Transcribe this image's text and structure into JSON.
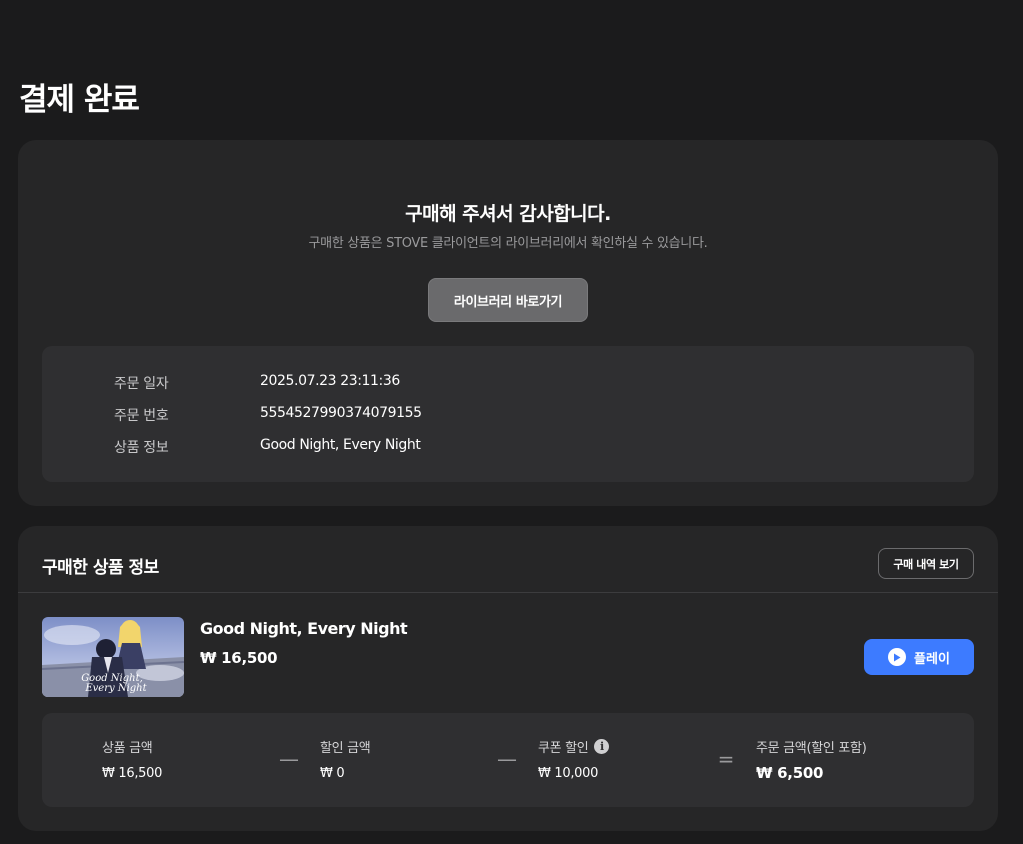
{
  "page": {
    "title": "결제 완료"
  },
  "completion": {
    "heading": "구매해 주셔서 감사합니다.",
    "subtext": "구매한 상품은 STOVE 클라이언트의 라이브러리에서 확인하실 수 있습니다.",
    "library_button": "라이브러리 바로가기",
    "order": {
      "date_label": "주문 일자",
      "date_value": "2025.07.23 23:11:36",
      "number_label": "주문 번호",
      "number_value": "5554527990374079155",
      "product_label": "상품 정보",
      "product_value": "Good Night, Every Night"
    }
  },
  "purchased": {
    "header": "구매한 상품 정보",
    "history_button": "구매 내역 보기",
    "product": {
      "name": "Good Night, Every Night",
      "price": "₩ 16,500",
      "thumbnail_text": "Good Night, Every Night"
    },
    "play_button": "플레이",
    "summary": {
      "product_amount_label": "상품 금액",
      "product_amount_value": "₩ 16,500",
      "discount_label": "할인 금액",
      "discount_value": "₩ 0",
      "coupon_label": "쿠폰 할인",
      "coupon_value": "₩ 10,000",
      "total_label": "주문 금액(할인 포함)",
      "total_value": "₩ 6,500",
      "minus_symbol": "—",
      "equals_symbol": "="
    }
  },
  "colors": {
    "background": "#1b1b1c",
    "card": "#262627",
    "inner_box": "#2f2f31",
    "accent_blue": "#3d7bff"
  },
  "icons": [
    "play-icon",
    "info-icon"
  ]
}
